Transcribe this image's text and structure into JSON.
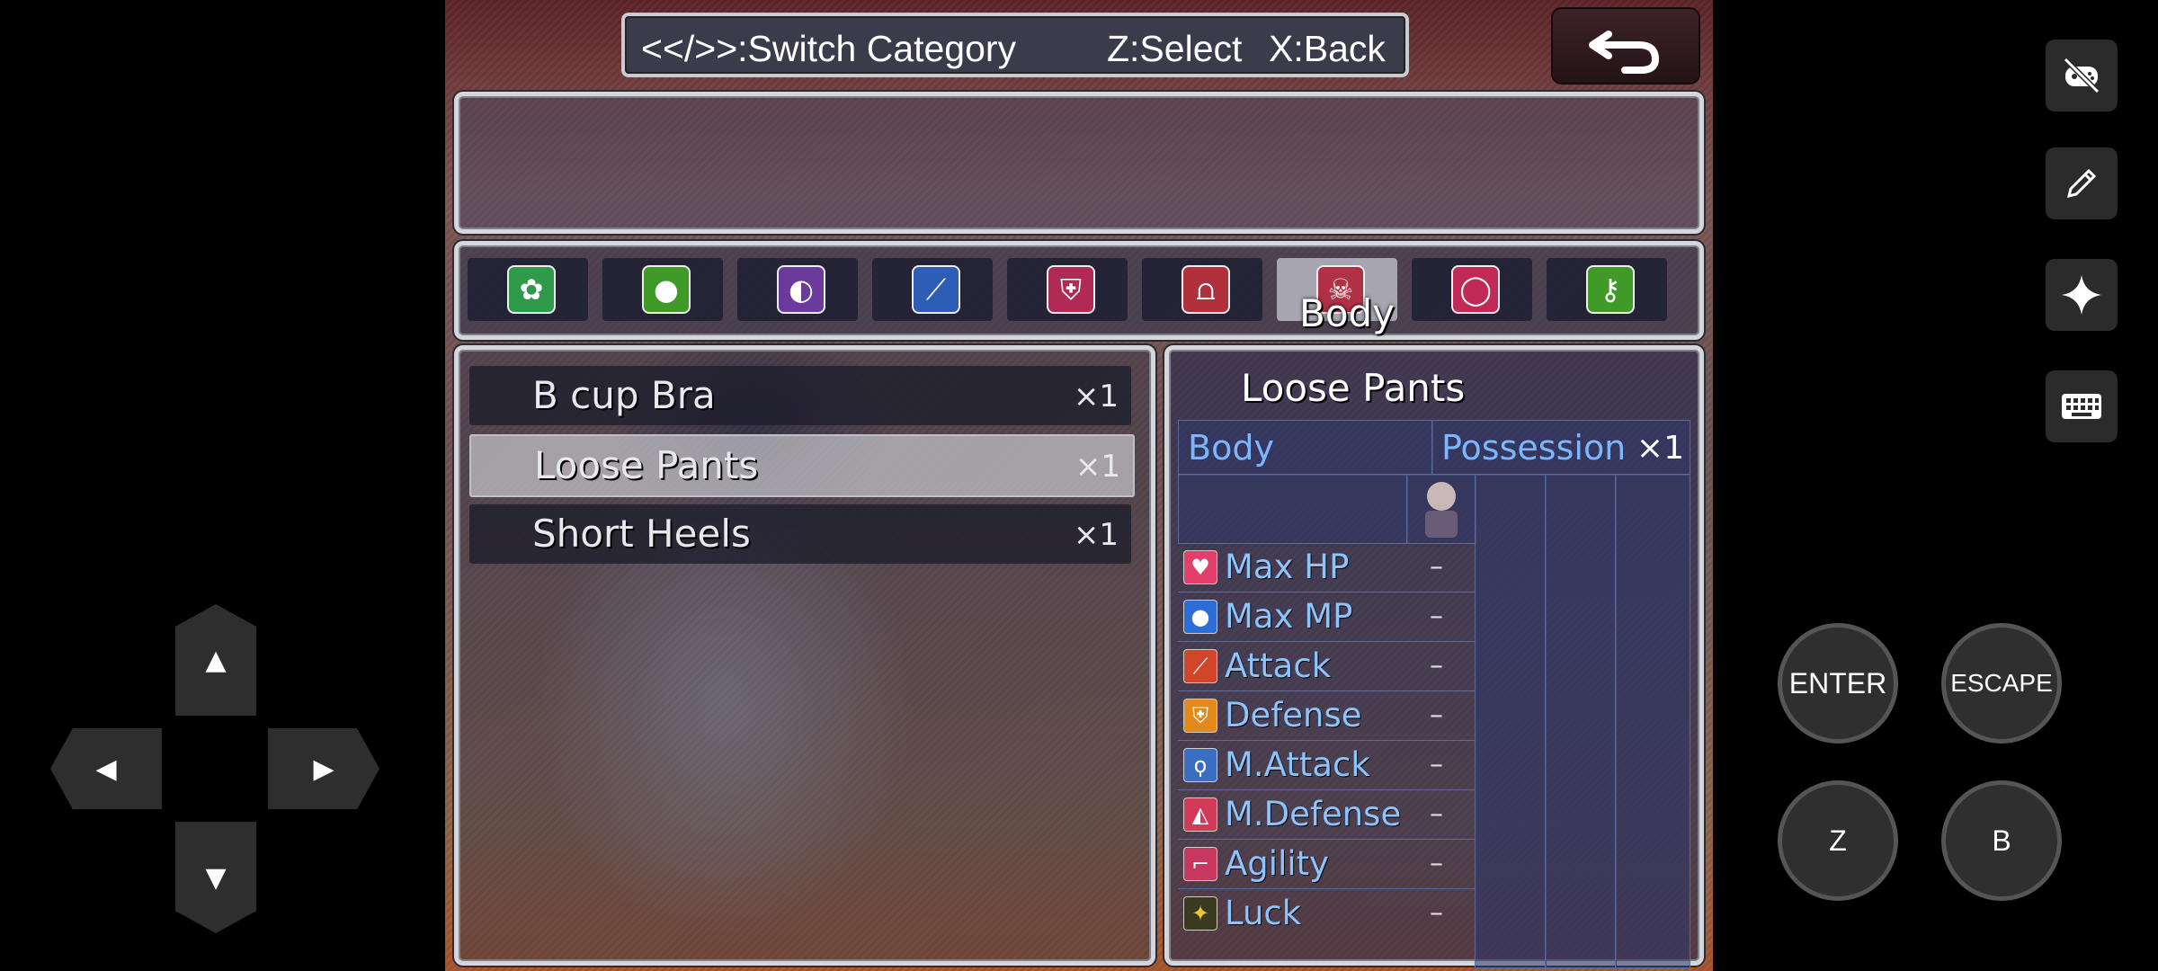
{
  "help": {
    "switch": "<</>>:Switch Category",
    "select": "Z:Select",
    "back": "X:Back"
  },
  "categories": {
    "icons": [
      "bag-icon",
      "bomb-icon",
      "orb-icon",
      "sword-icon",
      "shield-icon",
      "helmet-icon",
      "body-icon",
      "ring-icon",
      "key-icon"
    ],
    "selected_label": "Body"
  },
  "items": [
    {
      "name": "B cup Bra",
      "qty": "×1"
    },
    {
      "name": "Loose Pants",
      "qty": "×1"
    },
    {
      "name": "Short Heels",
      "qty": "×1"
    }
  ],
  "detail": {
    "title": "Loose Pants",
    "slot": "Body",
    "possession_label": "Possession",
    "possession_qty": "×1",
    "stats": [
      {
        "name": "Max HP",
        "icon": "heart-icon",
        "value": "–"
      },
      {
        "name": "Max MP",
        "icon": "mana-icon",
        "value": "–"
      },
      {
        "name": "Attack",
        "icon": "attack-icon",
        "value": "–"
      },
      {
        "name": "Defense",
        "icon": "defense-icon",
        "value": "–"
      },
      {
        "name": "M.Attack",
        "icon": "magic-attack-icon",
        "value": "–"
      },
      {
        "name": "M.Defense",
        "icon": "magic-defense-icon",
        "value": "–"
      },
      {
        "name": "Agility",
        "icon": "agility-icon",
        "value": "–"
      },
      {
        "name": "Luck",
        "icon": "luck-icon",
        "value": "–"
      }
    ]
  },
  "controls": {
    "enter": "ENTER",
    "escape": "ESCAPE",
    "z": "Z",
    "b": "B",
    "up": "▲",
    "down": "▼",
    "left": "◀",
    "right": "▶"
  }
}
